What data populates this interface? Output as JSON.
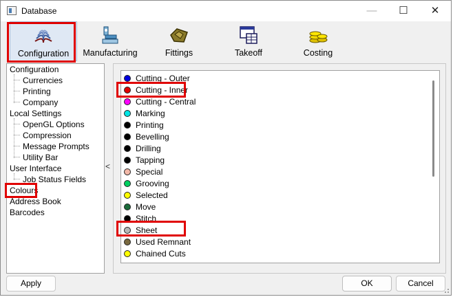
{
  "window": {
    "title": "Database",
    "min_glyph": "—",
    "max_glyph": "☐",
    "close_glyph": "✕"
  },
  "toolbar": {
    "buttons": [
      {
        "label": "Configuration",
        "icon": "book-icon"
      },
      {
        "label": "Manufacturing",
        "icon": "robot-arm-icon"
      },
      {
        "label": "Fittings",
        "icon": "fittings-icon"
      },
      {
        "label": "Takeoff",
        "icon": "takeoff-icon"
      },
      {
        "label": "Costing",
        "icon": "coins-icon"
      }
    ]
  },
  "tree": {
    "configuration": "Configuration",
    "currencies": "Currencies",
    "printing": "Printing",
    "company": "Company",
    "local_settings": "Local Settings",
    "opengl": "OpenGL Options",
    "compression": "Compression",
    "message_prompts": "Message Prompts",
    "utility_bar": "Utility Bar",
    "user_interface": "User Interface",
    "job_status": "Job Status Fields",
    "colours": "Colours",
    "address_book": "Address Book",
    "barcodes": "Barcodes"
  },
  "splitter_arrow": "<",
  "colours": [
    {
      "label": "Cutting - Outer",
      "color": "#0000e0"
    },
    {
      "label": "Cutting - Inner",
      "color": "#e00000"
    },
    {
      "label": "Cutting - Central",
      "color": "#ff00ff"
    },
    {
      "label": "Marking",
      "color": "#00e5e5"
    },
    {
      "label": "Printing",
      "color": "#000000"
    },
    {
      "label": "Bevelling",
      "color": "#000000"
    },
    {
      "label": "Drilling",
      "color": "#000000"
    },
    {
      "label": "Tapping",
      "color": "#000000"
    },
    {
      "label": "Special",
      "color": "#f2b8a8"
    },
    {
      "label": "Grooving",
      "color": "#00d060"
    },
    {
      "label": "Selected",
      "color": "#ffff00"
    },
    {
      "label": "Move",
      "color": "#1a6b3a"
    },
    {
      "label": "Stitch",
      "color": "#000000"
    },
    {
      "label": "Sheet",
      "color": "#b8b8b8"
    },
    {
      "label": "Used Remnant",
      "color": "#7a6a40"
    },
    {
      "label": "Chained Cuts",
      "color": "#ffff00"
    }
  ],
  "buttons": {
    "apply": "Apply",
    "ok": "OK",
    "cancel": "Cancel"
  }
}
